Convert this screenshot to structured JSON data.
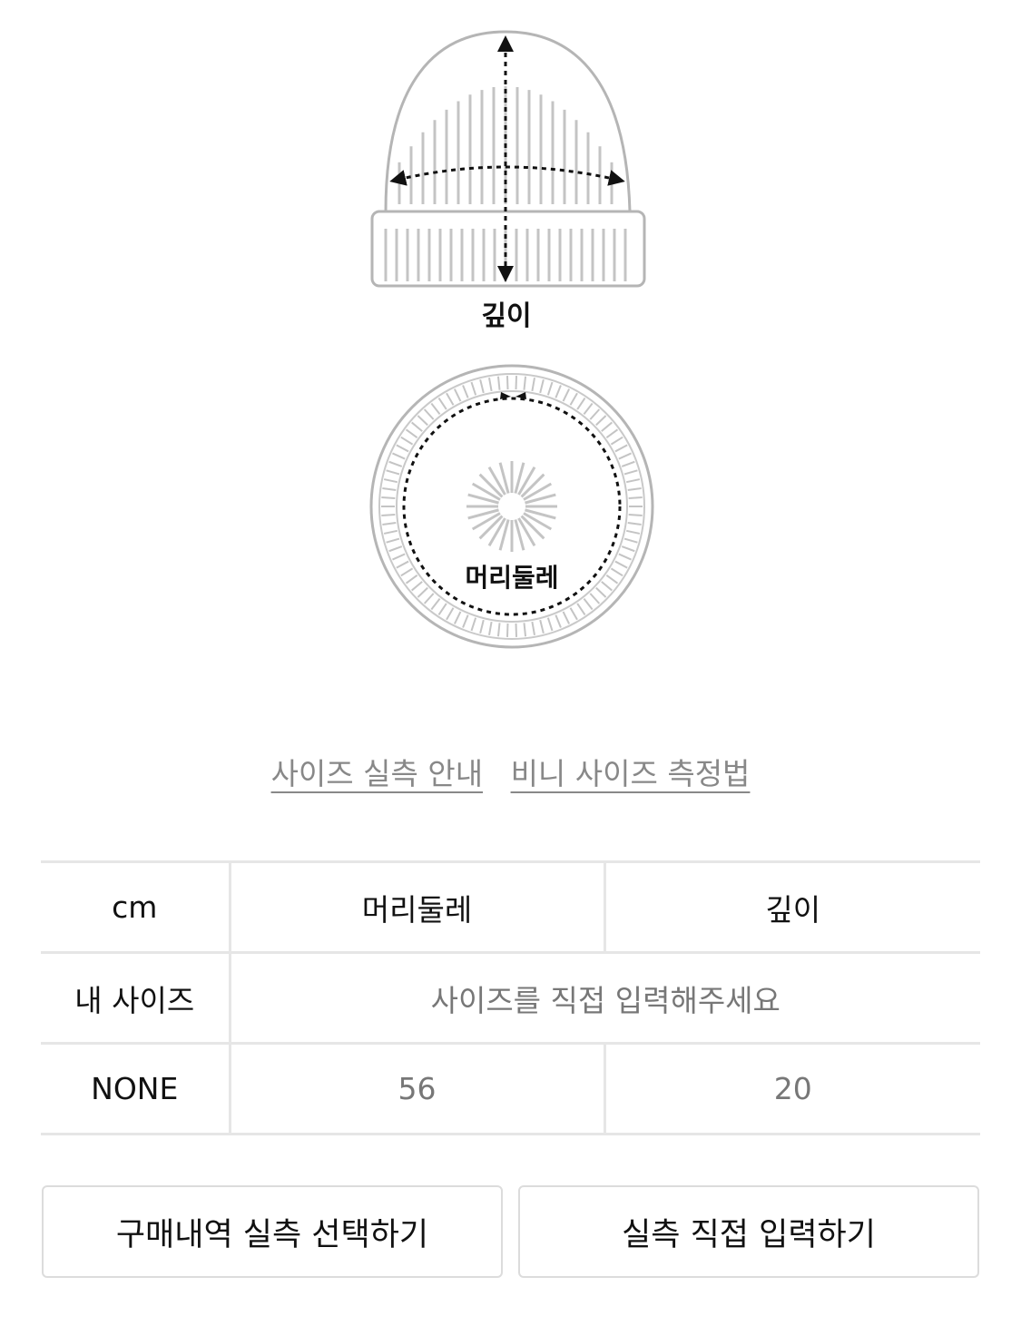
{
  "diagram": {
    "depth_label": "깊이",
    "circumference_label": "머리둘레"
  },
  "links": {
    "size_guide": "사이즈 실측 안내",
    "beanie_measure": "비니 사이즈 측정법"
  },
  "table": {
    "headers": [
      "cm",
      "머리둘레",
      "깊이"
    ],
    "my_size": {
      "label": "내 사이즈",
      "placeholder": "사이즈를 직접 입력해주세요"
    },
    "rows": [
      {
        "label": "NONE",
        "values": [
          "56",
          "20"
        ]
      }
    ]
  },
  "buttons": {
    "select_history": "구매내역 실측 선택하기",
    "direct_input": "실측 직접 입력하기"
  },
  "colors": {
    "line_gray": "#b5b5b5",
    "border": "#e6e6e6",
    "link_gray": "#888888",
    "value_gray": "#777777"
  }
}
